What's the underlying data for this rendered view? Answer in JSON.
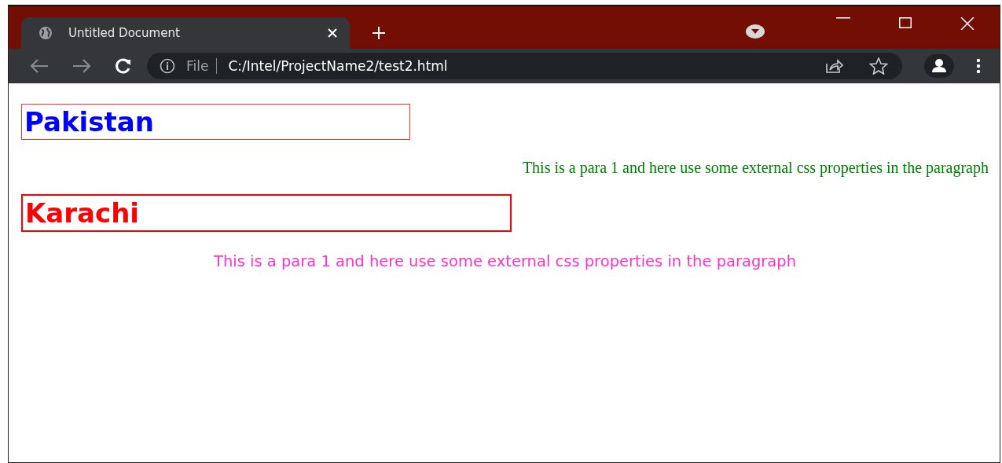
{
  "tabs": [
    {
      "title": "Untitled Document",
      "selected": true
    }
  ],
  "address_bar": {
    "scheme": "File",
    "url": "C:/Intel/ProjectName2/test2.html"
  },
  "content": [
    {
      "kind": "heading",
      "text": "Pakistan",
      "color": "#0000ff"
    },
    {
      "kind": "paragraph-right",
      "text": "This is a para 1 and here use some external css properties in the paragraph",
      "color": "#008000"
    },
    {
      "kind": "heading-bold-frame",
      "text": "Karachi",
      "color": "#ff0000"
    },
    {
      "kind": "paragraph-center",
      "text": "This is a para 1 and here use some external css properties in the paragraph",
      "color": "#ff33cc"
    }
  ]
}
